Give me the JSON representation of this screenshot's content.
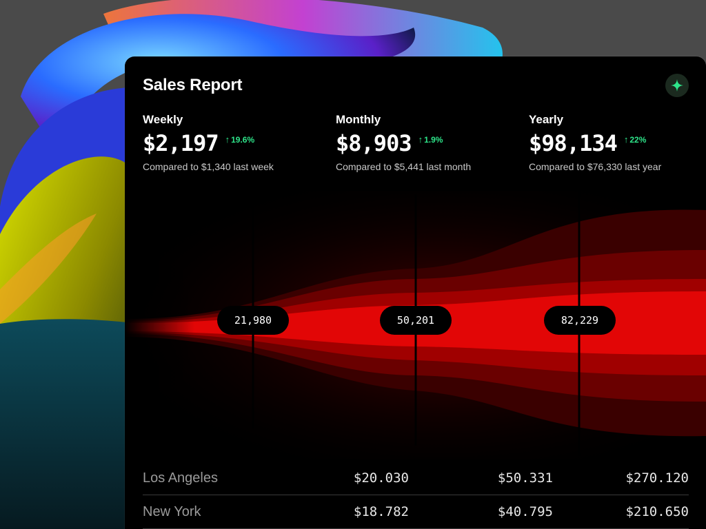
{
  "report": {
    "title": "Sales Report",
    "sparkle_icon": "sparkle-icon",
    "accent_color": "#2ee58a",
    "stats": [
      {
        "label": "Weekly",
        "value": "$2,197",
        "change": "19.6%",
        "compare": "Compared to $1,340 last week"
      },
      {
        "label": "Monthly",
        "value": "$8,903",
        "change": "1.9%",
        "compare": "Compared to $5,441 last month"
      },
      {
        "label": "Yearly",
        "value": "$98,134",
        "change": "22%",
        "compare": "Compared to $76,330 last year"
      }
    ],
    "markers": [
      "21,980",
      "50,201",
      "82,229"
    ],
    "table": [
      {
        "city": "Los Angeles",
        "v1": "$20.030",
        "v2": "$50.331",
        "v3": "$270.120"
      },
      {
        "city": "New York",
        "v1": "$18.782",
        "v2": "$40.795",
        "v3": "$210.650"
      }
    ]
  }
}
